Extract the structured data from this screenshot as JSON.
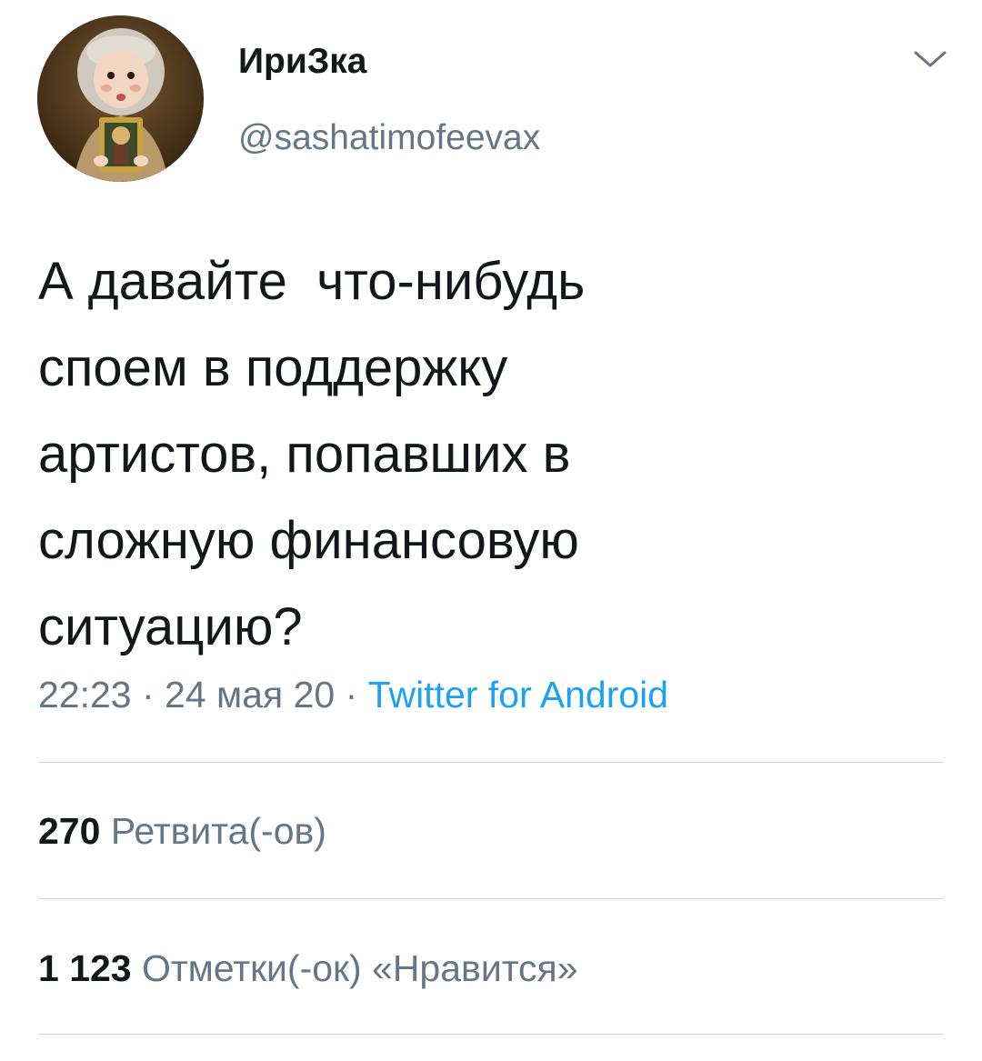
{
  "user": {
    "display_name": "ИриЗка",
    "handle": "@sashatimofeevax"
  },
  "tweet": {
    "text": "А давайте  что-нибудь\nспоем в поддержку\nартистов, попавших в\nсложную финансовую\nситуацию?",
    "time": "22:23",
    "date": "24 мая 20",
    "separator": " · ",
    "source": "Twitter for Android"
  },
  "stats": {
    "retweets_count": "270",
    "retweets_label": "Ретвита(-ов)",
    "likes_count": "1 123",
    "likes_label": "Отметки(-ок) «Нравится»"
  },
  "icons": {
    "menu": "chevron-down-icon",
    "avatar": "avatar"
  },
  "colors": {
    "text": "#14171a",
    "secondary": "#657786",
    "link": "#1da1f2",
    "divider": "#ccd6dd"
  }
}
